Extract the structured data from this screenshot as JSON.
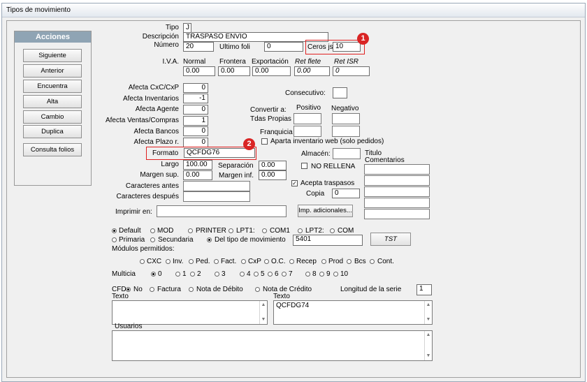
{
  "window": {
    "title": "Tipos de movimiento"
  },
  "acciones": {
    "title": "Acciones",
    "buttons": [
      "Siguiente",
      "Anterior",
      "Encuentra",
      "Alta",
      "Cambio",
      "Duplica",
      "Consulta folios"
    ]
  },
  "header": {
    "tipo_label": "Tipo",
    "tipo_value": "J",
    "descripcion_label": "Descripción",
    "descripcion_value": "TRASPASO ENVIO",
    "numero_label": "Número",
    "numero_value": "20",
    "ultimo_label": "Ultimo foli",
    "ultimo_value": "0",
    "ceros_label": "Ceros js",
    "ceros_value": "10"
  },
  "iva": {
    "label": "I.V.A.",
    "headers": [
      "Normal",
      "Frontera",
      "Exportación",
      "Ret flete",
      "Ret ISR"
    ],
    "values": [
      "0.00",
      "0.00",
      "0.00",
      "0.00",
      "0"
    ]
  },
  "afecta": {
    "labels": [
      "Afecta CxC/CxP",
      "Afecta Inventarios",
      "Afecta Agente",
      "Afecta Ventas/Compras",
      "Afecta Bancos",
      "Afecta Plazo r."
    ],
    "values": [
      "0",
      "-1",
      "0",
      "1",
      "0",
      "0"
    ]
  },
  "consecutivo": {
    "label": "Consecutivo:",
    "value": ""
  },
  "convertir": {
    "label": "Convertir a:",
    "positivo": "Positivo",
    "negativo": "Negativo",
    "tdas_label": "Tdas Propias",
    "franquicia_label": "Franquicia"
  },
  "aparta_label": "Aparta inventario web (solo pedidos)",
  "formato": {
    "label": "Formato",
    "value": "QCFDG76"
  },
  "almacen_label": "Almacén:",
  "titulo_label": "Titulo",
  "comentarios_label": "Comentarios",
  "largo": {
    "label": "Largo",
    "value": "100.00"
  },
  "separacion": {
    "label": "Separación",
    "value": "0.00"
  },
  "margen_sup": {
    "label": "Margen sup.",
    "value": "0.00"
  },
  "margen_inf": {
    "label": "Margen inf.",
    "value": "0.00"
  },
  "no_rellena_label": "NO RELLENA",
  "acepta_label": "Acepta traspasos",
  "copia": {
    "label": "Copia",
    "value": "0"
  },
  "caracteres_antes_label": "Caracteres antes",
  "caracteres_despues_label": "Caracteres después",
  "imprimir_label": "Imprimir en:",
  "imp_adicionales_label": "Imp. adicionales...",
  "output_opts": [
    "Default",
    "MOD",
    "PRINTER",
    "LPT1:",
    "COM1",
    "LPT2:",
    "COM"
  ],
  "bodega_opts": [
    "Primaria",
    "Secundaria",
    "Del tipo de movimiento"
  ],
  "bodega_value": "5401",
  "tst_label": "TST",
  "modulos_label": "Módulos permitidos:",
  "modulos": [
    "CXC",
    "Inv.",
    "Ped.",
    "Fact.",
    "CxP",
    "O.C.",
    "Recep",
    "Prod",
    "Bcs",
    "Cont."
  ],
  "multicia_label": "Multicia",
  "multicia_opts": [
    "0",
    "1",
    "2",
    "3",
    "4",
    "5",
    "6",
    "7",
    "8",
    "9",
    "10"
  ],
  "cfd_label": "CFD",
  "cfd_opts": [
    "No",
    "Factura",
    "Nota de Débito",
    "Nota de Crédito"
  ],
  "longitud": {
    "label": "Longitud de la serie",
    "value": "1"
  },
  "texto_left_label": "Texto",
  "texto_right_label": "Texto",
  "texto_right_value": "QCFDG74",
  "usuarios_label": "Usuarios",
  "badges": [
    "1",
    "2"
  ],
  "colors": {
    "accent_header": "#8fa4b4",
    "highlight": "#e02020"
  }
}
